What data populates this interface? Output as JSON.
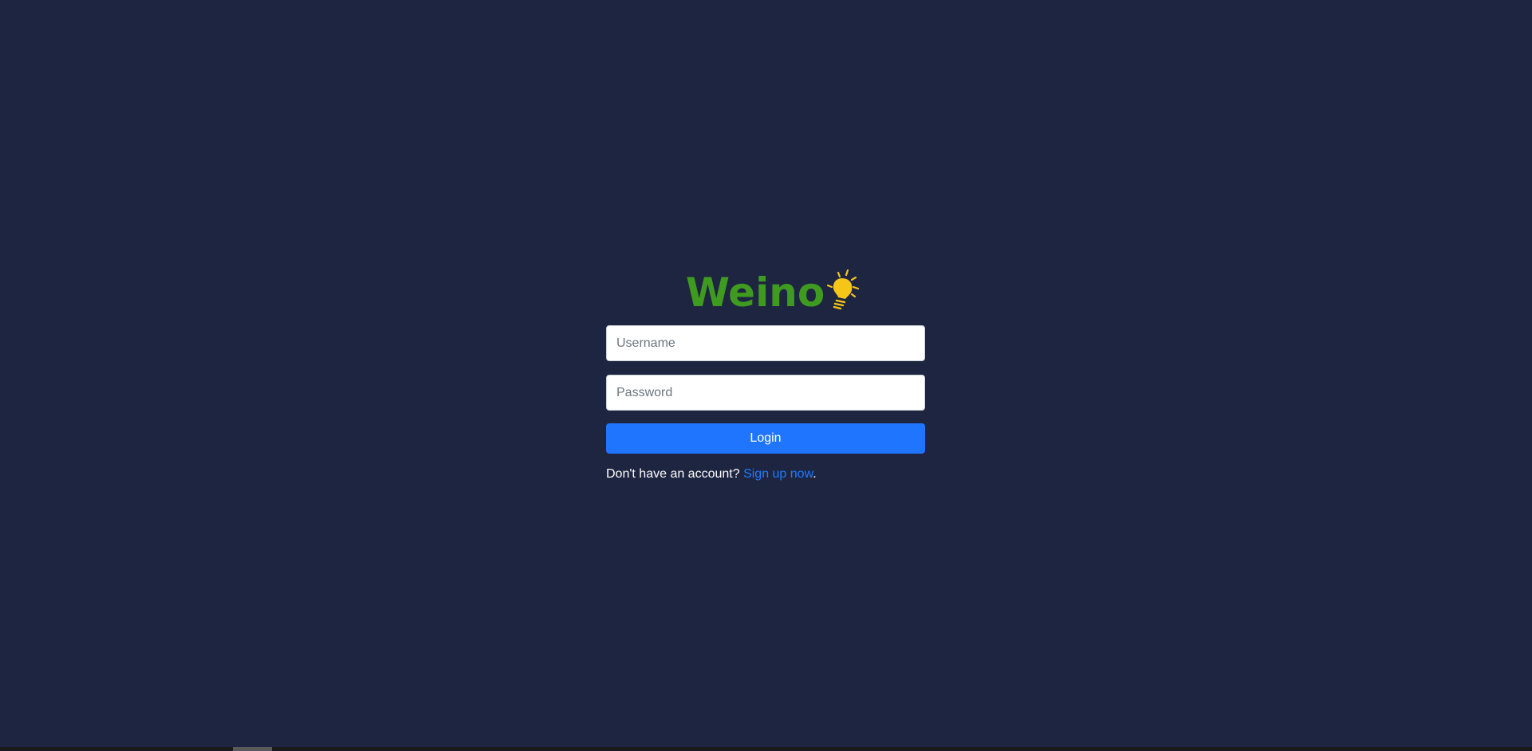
{
  "app": {
    "logo_text": "Weino",
    "logo_icon": "lightbulb-icon",
    "colors": {
      "background": "#1e2540",
      "logo_text": "#3f9b1f",
      "bulb": "#f5c518",
      "primary": "#1f75fe",
      "link": "#1f7bff"
    }
  },
  "form": {
    "username_placeholder": "Username",
    "username_value": "",
    "password_placeholder": "Password",
    "password_value": "",
    "login_label": "Login"
  },
  "signup": {
    "prompt": "Don't have an account? ",
    "link_label": "Sign up now",
    "suffix": "."
  }
}
